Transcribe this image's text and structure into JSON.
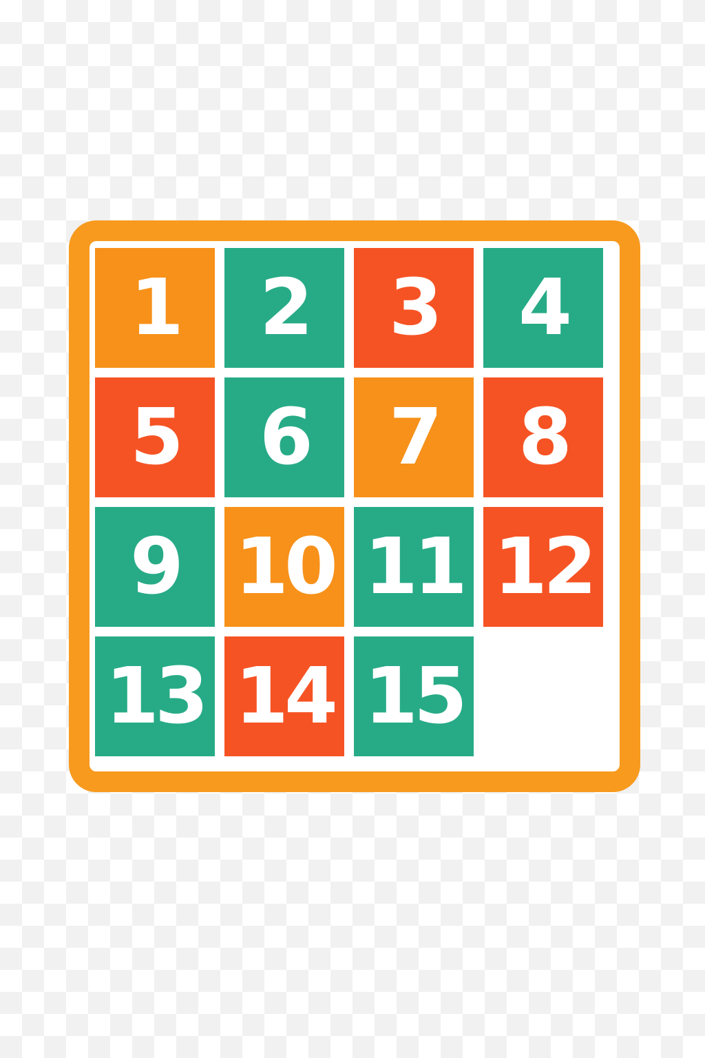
{
  "colors": {
    "frame": "#f79a1e",
    "orange": "#f7911a",
    "teal": "#27ab87",
    "red": "#f65324"
  },
  "board": {
    "rows": 4,
    "cols": 4,
    "tiles": [
      {
        "label": "1",
        "color": "orange"
      },
      {
        "label": "2",
        "color": "teal"
      },
      {
        "label": "3",
        "color": "red"
      },
      {
        "label": "4",
        "color": "teal"
      },
      {
        "label": "5",
        "color": "red"
      },
      {
        "label": "6",
        "color": "teal"
      },
      {
        "label": "7",
        "color": "orange"
      },
      {
        "label": "8",
        "color": "red"
      },
      {
        "label": "9",
        "color": "teal"
      },
      {
        "label": "10",
        "color": "orange"
      },
      {
        "label": "11",
        "color": "teal"
      },
      {
        "label": "12",
        "color": "red"
      },
      {
        "label": "13",
        "color": "teal"
      },
      {
        "label": "14",
        "color": "red"
      },
      {
        "label": "15",
        "color": "teal"
      },
      {
        "label": "",
        "color": "empty"
      }
    ]
  }
}
